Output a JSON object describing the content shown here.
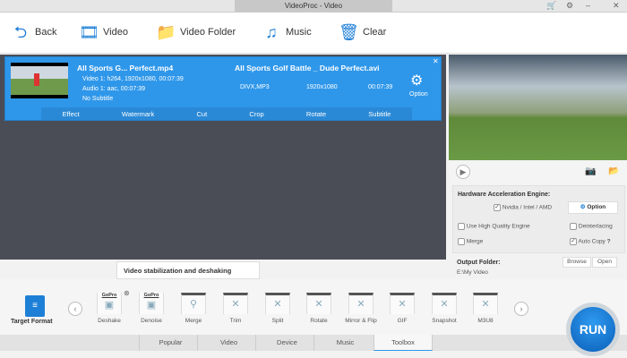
{
  "window": {
    "title": "VideoProc - Video"
  },
  "toolbar": {
    "back": "Back",
    "video": "Video",
    "video_folder": "Video Folder",
    "music": "Music",
    "clear": "Clear"
  },
  "file": {
    "source_name": "All Sports G... Perfect.mp4",
    "video_track": "Video 1: h264, 1920x1080, 00:07:39",
    "audio_track": "Audio 1: aac, 00:07:39",
    "subtitle": "No Subtitle",
    "output_name": "All Sports Golf Battle _ Dude Perfect.avi",
    "codec": "DIVX,MP3",
    "resolution": "1920x1080",
    "duration": "00:07:39",
    "option": "Option"
  },
  "edit": [
    "Effect",
    "Watermark",
    "Cut",
    "Crop",
    "Rotate",
    "Subtitle"
  ],
  "settings": {
    "hw_title": "Hardware Acceleration Engine:",
    "hw_option": "Nvidia / Intel / AMD",
    "option_btn": "Option",
    "high_quality": "Use High Quality Engine",
    "deinterlacing": "Deinterlacing",
    "merge": "Merge",
    "auto_copy": "Auto Copy",
    "help": "?",
    "output_folder_label": "Output Folder:",
    "output_folder": "E:\\My Video",
    "browse": "Browse",
    "open": "Open"
  },
  "tooltip": "Video stabilization and deshaking",
  "target_format": "Target Format",
  "tools": [
    {
      "label": "Deshake",
      "brand": "GoPro"
    },
    {
      "label": "Denoise",
      "brand": "GoPro"
    },
    {
      "label": "Merge"
    },
    {
      "label": "Trim"
    },
    {
      "label": "Split"
    },
    {
      "label": "Rotate"
    },
    {
      "label": "Mirror & Flip"
    },
    {
      "label": "GIF"
    },
    {
      "label": "Snapshot"
    },
    {
      "label": "M3U8"
    }
  ],
  "tabs": [
    "Popular",
    "Video",
    "Device",
    "Music",
    "Toolbox"
  ],
  "active_tab": "Toolbox",
  "run": "RUN",
  "accent": "#2f97ea"
}
